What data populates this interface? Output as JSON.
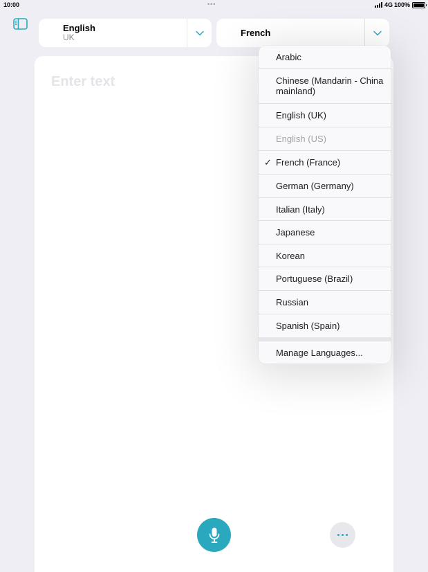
{
  "status_bar": {
    "time": "10:00",
    "center_indicator": "•••",
    "network": "4G",
    "battery": "100%",
    "battery_level": 1.0
  },
  "sidebar_toggle": {
    "icon": "sidebar-icon"
  },
  "source_language": {
    "name": "English",
    "region": "UK",
    "icon": "chevron-down-icon"
  },
  "target_language": {
    "name": "French",
    "icon": "chevron-down-icon"
  },
  "input": {
    "placeholder": "Enter text"
  },
  "controls": {
    "mic_icon": "microphone-icon",
    "more_icon": "ellipsis-icon"
  },
  "language_menu": {
    "items": [
      {
        "label": "Arabic",
        "checked": false,
        "disabled": false
      },
      {
        "label": "Chinese (Mandarin - China mainland)",
        "checked": false,
        "disabled": false
      },
      {
        "label": "English (UK)",
        "checked": false,
        "disabled": false
      },
      {
        "label": "English (US)",
        "checked": false,
        "disabled": true
      },
      {
        "label": "French (France)",
        "checked": true,
        "disabled": false
      },
      {
        "label": "German (Germany)",
        "checked": false,
        "disabled": false
      },
      {
        "label": "Italian (Italy)",
        "checked": false,
        "disabled": false
      },
      {
        "label": "Japanese",
        "checked": false,
        "disabled": false
      },
      {
        "label": "Korean",
        "checked": false,
        "disabled": false
      },
      {
        "label": "Portuguese (Brazil)",
        "checked": false,
        "disabled": false
      },
      {
        "label": "Russian",
        "checked": false,
        "disabled": false
      },
      {
        "label": "Spanish (Spain)",
        "checked": false,
        "disabled": false
      }
    ],
    "check_mark": "✓",
    "manage_label": "Manage Languages..."
  },
  "colors": {
    "accent": "#2aa9be",
    "background": "#efeef5",
    "panel": "#ffffff",
    "secondary_text": "#8e8e93",
    "disabled_text": "#a3a3a8"
  }
}
